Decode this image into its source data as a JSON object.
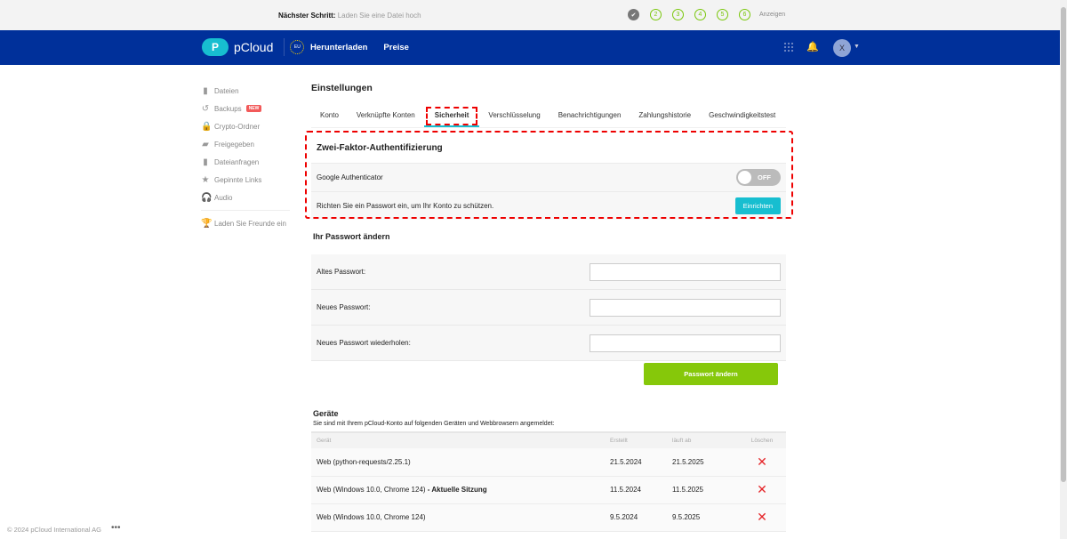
{
  "topbar": {
    "next_label": "Nächster Schritt:",
    "next_text": "Laden Sie eine Datei hoch",
    "steps": [
      "2",
      "3",
      "4",
      "5",
      "6"
    ],
    "show": "Anzeigen"
  },
  "header": {
    "brand": "pCloud",
    "logo_letter": "P",
    "eu": "EU",
    "nav": [
      "Herunterladen",
      "Preise"
    ],
    "avatar": "X"
  },
  "sidebar": {
    "items": [
      "Dateien",
      "Backups",
      "Crypto-Ordner",
      "Freigegeben",
      "Dateianfragen",
      "Gepinnte Links",
      "Audio"
    ],
    "new_badge": "NEW",
    "invite": "Laden Sie Freunde ein"
  },
  "footer": {
    "copyright": "© 2024 pCloud International AG"
  },
  "main": {
    "title": "Einstellungen",
    "tabs": [
      "Konto",
      "Verknüpfte Konten",
      "Sicherheit",
      "Verschlüsselung",
      "Benachrichtigungen",
      "Zahlungshistorie",
      "Geschwindigkeitstest"
    ],
    "twofa": {
      "title": "Zwei-Faktor-Authentifizierung",
      "google": "Google Authenticator",
      "toggle": "OFF",
      "setup_text": "Richten Sie ein Passwort ein, um Ihr Konto zu schützen.",
      "setup_button": "Einrichten"
    },
    "password": {
      "title": "Ihr Passwort ändern",
      "fields": [
        "Altes Passwort:",
        "Neues Passwort:",
        "Neues Passwort wiederholen:"
      ],
      "button": "Passwort ändern"
    },
    "devices": {
      "title": "Geräte",
      "subtitle": "Sie sind mit Ihrem pCloud-Konto auf folgenden Geräten und Webbrowsern angemeldet:",
      "headers": [
        "Gerät",
        "Erstellt",
        "läuft ab",
        "Löschen"
      ],
      "rows": [
        {
          "device": "Web (python-requests/2.25.1)",
          "current": "",
          "created": "21.5.2024",
          "expires": "21.5.2025"
        },
        {
          "device": "Web (Windows 10.0, Chrome 124)",
          "current": " - Aktuelle Sitzung",
          "created": "11.5.2024",
          "expires": "11.5.2025"
        },
        {
          "device": "Web (Windows 10.0, Chrome 124)",
          "current": "",
          "created": "9.5.2024",
          "expires": "9.5.2025"
        }
      ]
    }
  }
}
